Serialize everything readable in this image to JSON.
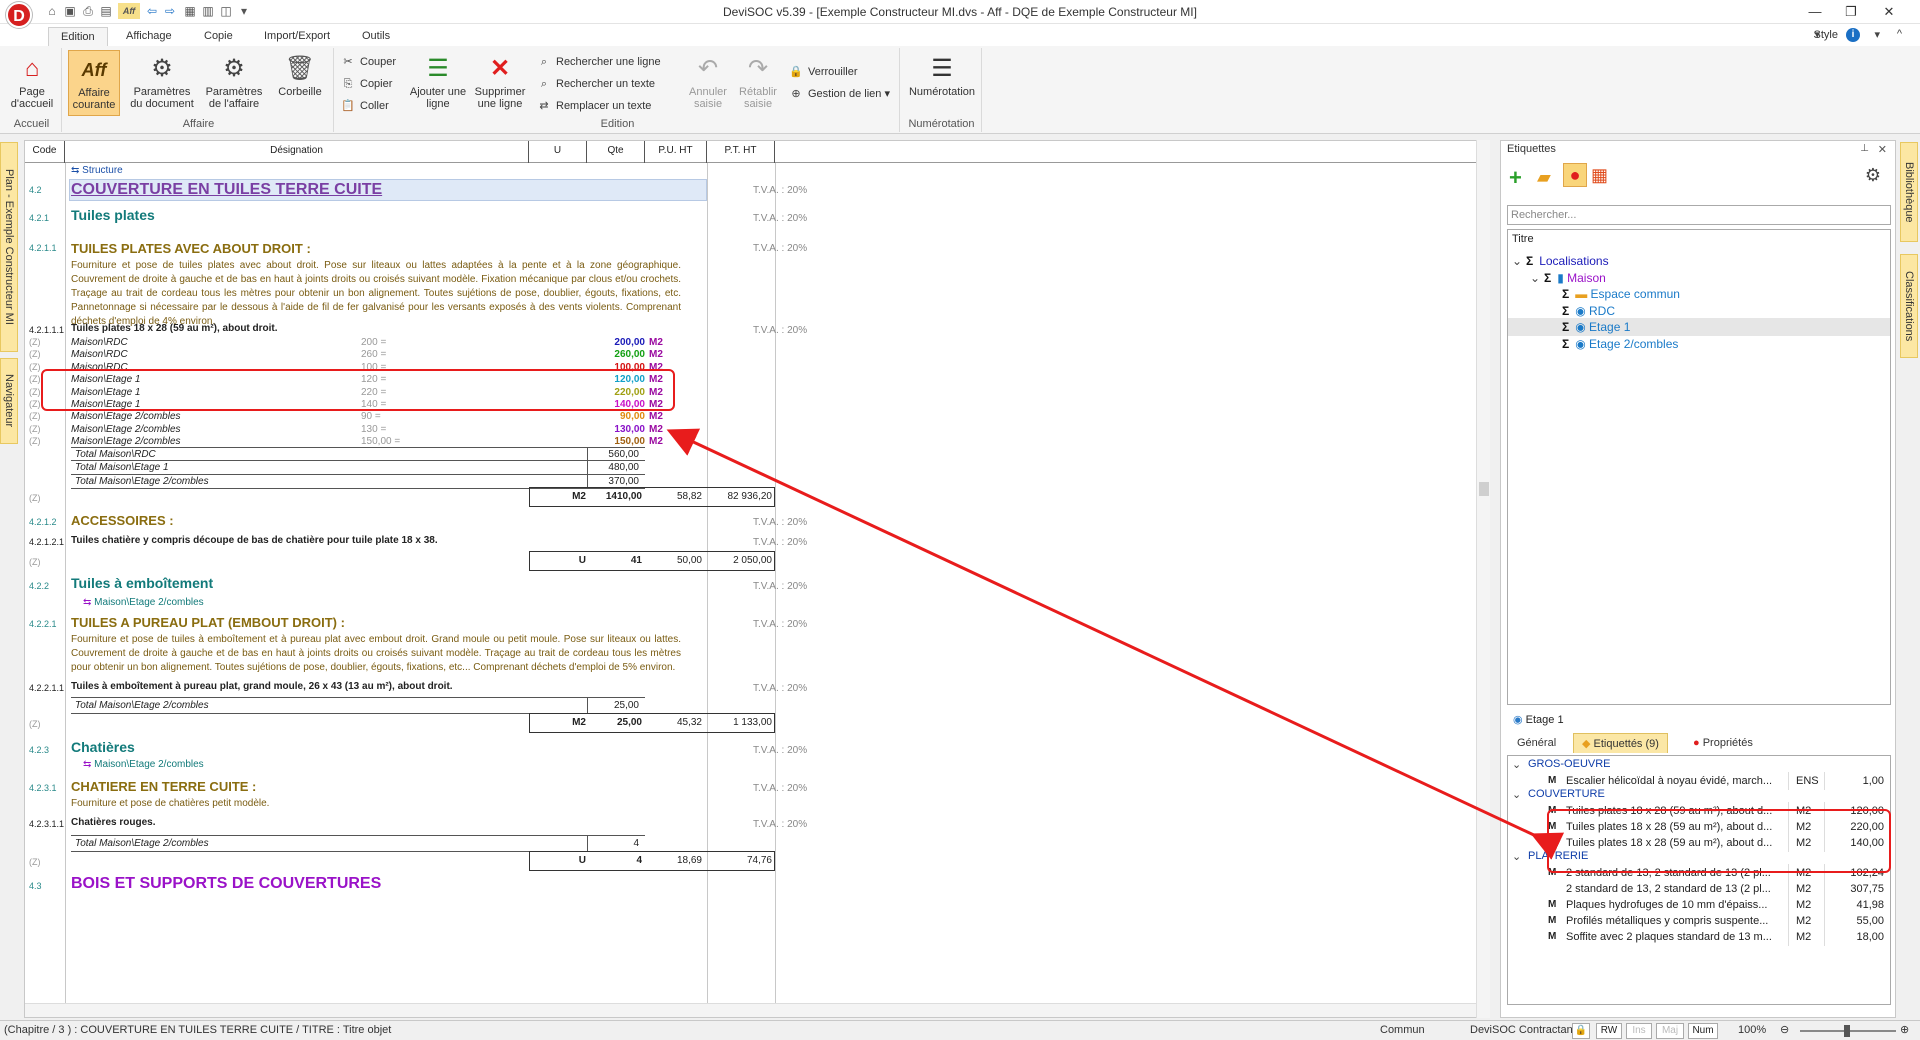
{
  "titlebar": {
    "app_logo": "D",
    "title": "DeviSOC v5.39 - [Exemple Constructeur MI.dvs - Aff - DQE de Exemple Constructeur MI]",
    "quick_aff": "Aff"
  },
  "menu": {
    "tabs": [
      "Edition",
      "Affichage",
      "Copie",
      "Import/Export",
      "Outils"
    ],
    "active_tab": "Edition",
    "style_label": "Style"
  },
  "ribbon": {
    "accueil": {
      "btn": "Page\nd'accueil",
      "group": "Accueil"
    },
    "affaire": {
      "group": "Affaire",
      "affaire_courante": "Affaire courante",
      "affaire_logo": "Aff",
      "param_doc": "Paramètres du document",
      "param_aff": "Paramètres de l'affaire",
      "corbeille": "Corbeille"
    },
    "edition": {
      "group": "Edition",
      "couper": "Couper",
      "copier": "Copier",
      "coller": "Coller",
      "ajouter": "Ajouter une ligne",
      "supprimer": "Supprimer une ligne",
      "rechercher_ligne": "Rechercher une ligne",
      "rechercher_texte": "Rechercher un texte",
      "remplacer_texte": "Remplacer un texte",
      "annuler": "Annuler saisie",
      "retablir": "Rétablir saisie",
      "verrouiller": "Verrouiller",
      "gestion_lien": "Gestion de lien"
    },
    "numerotation": {
      "btn": "Numérotation",
      "group": "Numérotation"
    }
  },
  "left_tabs": [
    "Plan - Exemple Constructeur MI",
    "Navigateur"
  ],
  "doc": {
    "columns": [
      "Code",
      "Désignation",
      "U",
      "Qte",
      "P.U. HT",
      "P.T. HT"
    ],
    "structure_label": "Structure",
    "tva": "T.V.A. : 20%",
    "chap_code": "4.2",
    "chap_title": "COUVERTURE EN TUILES TERRE CUITE",
    "sub1_code": "4.2.1",
    "sub1_title": "Tuiles plates",
    "art1_code": "4.2.1.1",
    "art1_title": "TUILES PLATES AVEC ABOUT DROIT :",
    "art1_desc": "Fourniture et pose de tuiles plates avec about droit. Pose sur liteaux ou lattes adaptées à la pente et à la zone géographique. Couvrement de droite à gauche et de bas en haut à joints droits ou croisés suivant modèle. Fixation mécanique par clous et/ou crochets. Traçage au trait de cordeau tous les mètres pour obtenir un bon alignement. Toutes sujétions de pose, doublier, égouts, fixations, etc. Pannetonnage si nécessaire par le dessous à l'aide de fil de fer galvanisé pour les versants exposés à des vents violents. Comprenant déchets d'emploi de 4% environ.",
    "item1_code": "4.2.1.1.1",
    "item1_title": "Tuiles plates 18 x 28 (59 au m²), about droit.",
    "z": "(Z)",
    "rows": [
      {
        "loc": "Maison\\RDC",
        "formula": "200 =",
        "val": "200,00",
        "unit": "M2",
        "color": "#1a1ab8"
      },
      {
        "loc": "Maison\\RDC",
        "formula": "260 =",
        "val": "260,00",
        "unit": "M2",
        "color": "#14a014"
      },
      {
        "loc": "Maison\\RDC",
        "formula": "100 =",
        "val": "100,00",
        "unit": "M2",
        "color": "#d41414"
      },
      {
        "loc": "Maison\\Etage 1",
        "formula": "120 =",
        "val": "120,00",
        "unit": "M2",
        "color": "#12a0c8"
      },
      {
        "loc": "Maison\\Etage 1",
        "formula": "220 =",
        "val": "220,00",
        "unit": "M2",
        "color": "#a0a012"
      },
      {
        "loc": "Maison\\Etage 1",
        "formula": "140 =",
        "val": "140,00",
        "unit": "M2",
        "color": "#c812c8"
      },
      {
        "loc": "Maison\\Etage 2/combles",
        "formula": "90 =",
        "val": "90,00",
        "unit": "M2",
        "color": "#e08a10"
      },
      {
        "loc": "Maison\\Etage 2/combles",
        "formula": "130 =",
        "val": "130,00",
        "unit": "M2",
        "color": "#8a12c8"
      },
      {
        "loc": "Maison\\Etage 2/combles",
        "formula": "150,00 =",
        "val": "150,00",
        "unit": "M2",
        "color": "#a06010"
      }
    ],
    "totals": [
      {
        "label": "Total Maison\\RDC",
        "val": "560,00"
      },
      {
        "label": "Total Maison\\Etage 1",
        "val": "480,00"
      },
      {
        "label": "Total Maison\\Etage 2/combles",
        "val": "370,00"
      }
    ],
    "sum1": {
      "unit": "M2",
      "qte": "1410,00",
      "pu": "58,82",
      "pt": "82 936,20"
    },
    "acc_code": "4.2.1.2",
    "acc_title": "ACCESSOIRES :",
    "acc_item_code": "4.2.1.2.1",
    "acc_item": "Tuiles chatière y compris découpe de bas de chatière pour tuile plate 18 x 38.",
    "sum2": {
      "unit": "U",
      "qte": "41",
      "pu": "50,00",
      "pt": "2 050,00"
    },
    "sub2_code": "4.2.2",
    "sub2_title": "Tuiles à emboîtement",
    "link_loc": "Maison\\Etage 2/combles",
    "art2_code": "4.2.2.1",
    "art2_title": "TUILES A PUREAU PLAT (EMBOUT DROIT) :",
    "art2_desc": "Fourniture et pose de tuiles à emboîtement et à pureau plat avec embout droit. Grand moule ou petit moule. Pose sur liteaux ou lattes. Couvrement de droite à gauche et de bas en haut à joints droits ou croisés suivant modèle. Traçage au trait de cordeau tous les mètres pour obtenir un bon alignement. Toutes sujétions de pose, doublier, égouts, fixations, etc... Comprenant déchets d'emploi de 5% environ.",
    "item2_code": "4.2.2.1.1",
    "item2_title": "Tuiles à emboîtement à pureau plat, grand moule, 26 x 43 (13 au m²), about droit.",
    "total2": {
      "label": "Total Maison\\Etage 2/combles",
      "val": "25,00"
    },
    "sum3": {
      "unit": "M2",
      "qte": "25,00",
      "pu": "45,32",
      "pt": "1 133,00"
    },
    "sub3_code": "4.2.3",
    "sub3_title": "Chatières",
    "art3_code": "4.2.3.1",
    "art3_title": "CHATIERE EN TERRE CUITE :",
    "art3_desc": "Fourniture et pose de chatières petit modèle.",
    "item3_code": "4.2.3.1.1",
    "item3_title": "Chatières rouges.",
    "total3": {
      "label": "Total Maison\\Etage 2/combles",
      "val": "4"
    },
    "sum4": {
      "unit": "U",
      "qte": "4",
      "pu": "18,69",
      "pt": "74,76"
    },
    "next_code": "4.3",
    "next_title": "BOIS ET SUPPORTS DE COUVERTURES"
  },
  "right_panel": {
    "title": "Etiquettes",
    "search_placeholder": "Rechercher...",
    "tree_header": "Titre",
    "tree": [
      {
        "label": "Localisations",
        "level": 0
      },
      {
        "label": "Maison",
        "level": 1
      },
      {
        "label": "Espace commun",
        "level": 2
      },
      {
        "label": "RDC",
        "level": 2
      },
      {
        "label": "Etage 1",
        "level": 2
      },
      {
        "label": "Etage 2/combles",
        "level": 2
      }
    ],
    "selected_label": "Etage 1",
    "tabs": [
      "Général",
      "Etiquettés (9)",
      "Propriétés"
    ],
    "groups": [
      {
        "name": "GROS-OEUVRE",
        "rows": [
          {
            "m": "M",
            "desc": "Escalier hélicoïdal à noyau évidé, march...",
            "unit": "ENS",
            "qty": "1,00"
          }
        ]
      },
      {
        "name": "COUVERTURE",
        "rows": [
          {
            "m": "M",
            "desc": "Tuiles plates 18 x 28 (59 au m²), about d...",
            "unit": "M2",
            "qty": "120,00"
          },
          {
            "m": "M",
            "desc": "Tuiles plates 18 x 28 (59 au m²), about d...",
            "unit": "M2",
            "qty": "220,00"
          },
          {
            "m": "M",
            "desc": "Tuiles plates 18 x 28 (59 au m²), about d...",
            "unit": "M2",
            "qty": "140,00"
          }
        ]
      },
      {
        "name": "PLATRERIE",
        "rows": [
          {
            "m": "M",
            "desc": "2 standard de 13, 2 standard de 13 (2 pl...",
            "unit": "M2",
            "qty": "102,24"
          },
          {
            "m": "",
            "desc": "2 standard de 13, 2 standard de 13 (2 pl...",
            "unit": "M2",
            "qty": "307,75"
          },
          {
            "m": "M",
            "desc": "Plaques hydrofuges de 10 mm d'épaiss...",
            "unit": "M2",
            "qty": "41,98"
          },
          {
            "m": "M",
            "desc": "Profilés métalliques y compris suspente...",
            "unit": "M2",
            "qty": "55,00"
          },
          {
            "m": "M",
            "desc": "Soffite avec 2 plaques standard de 13 m...",
            "unit": "M2",
            "qty": "18,00"
          }
        ]
      }
    ]
  },
  "right_vtabs": [
    "Bibliothèque",
    "Classifications"
  ],
  "status": {
    "path": "(Chapitre / 3 ) : COUVERTURE EN TUILES TERRE CUITE / TITRE : Titre objet",
    "commun": "Commun",
    "contractant": "DeviSOC Contractant",
    "rw": "RW",
    "ins": "Ins",
    "maj": "Maj",
    "num": "Num",
    "zoom": "100%"
  }
}
